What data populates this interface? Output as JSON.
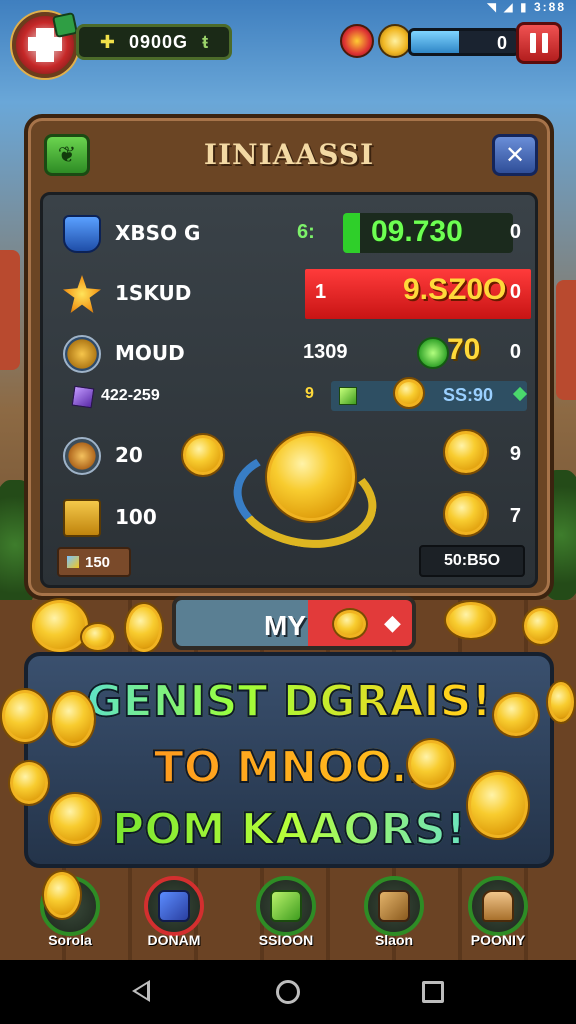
{
  "status_bar": {
    "time": "3:88",
    "icons": [
      "wifi-icon",
      "signal-icon",
      "battery-icon"
    ]
  },
  "hud": {
    "xp_prefix": "✚",
    "xp_value": "0900G",
    "xp_suffix": "ŧ",
    "energy_value": "0",
    "energy_fill": 0.45
  },
  "panel": {
    "title": "IINIAASSI",
    "close_symbol": "✕",
    "rows": [
      {
        "label": "XBSO G",
        "mid": "6:",
        "value": "09.730",
        "end": "0"
      },
      {
        "label": "1SKUD",
        "left": "1",
        "value": "9.SZ0O",
        "end": "0"
      },
      {
        "label": "MOUD",
        "mid": "1309",
        "value": "70",
        "end": "0"
      },
      {
        "label": "422-259",
        "tick": "9",
        "value": "SS:90"
      },
      {
        "label": "20",
        "end": "9"
      },
      {
        "label": "100",
        "end": "7"
      }
    ],
    "footer_left": "150",
    "footer_right": "50:B5O"
  },
  "my_button": {
    "label": "MY",
    "arrow": "◆"
  },
  "banner": {
    "line1": "GENIST DGRAIS!",
    "line2": "TO MNOO..",
    "line3": "POM KAAORS!"
  },
  "nav": [
    {
      "label": "Sorola",
      "icon": "coin-icon"
    },
    {
      "label": "DONAM",
      "icon": "map-icon"
    },
    {
      "label": "SSIOON",
      "icon": "chest-icon"
    },
    {
      "label": "Slaon",
      "icon": "tool-icon"
    },
    {
      "label": "POONIY",
      "icon": "character-icon"
    }
  ],
  "colors": {
    "accent_green": "#2fcf2a",
    "accent_red": "#e23a3a",
    "gold": "#f8cc2f",
    "panel_wood": "#6b4524"
  }
}
